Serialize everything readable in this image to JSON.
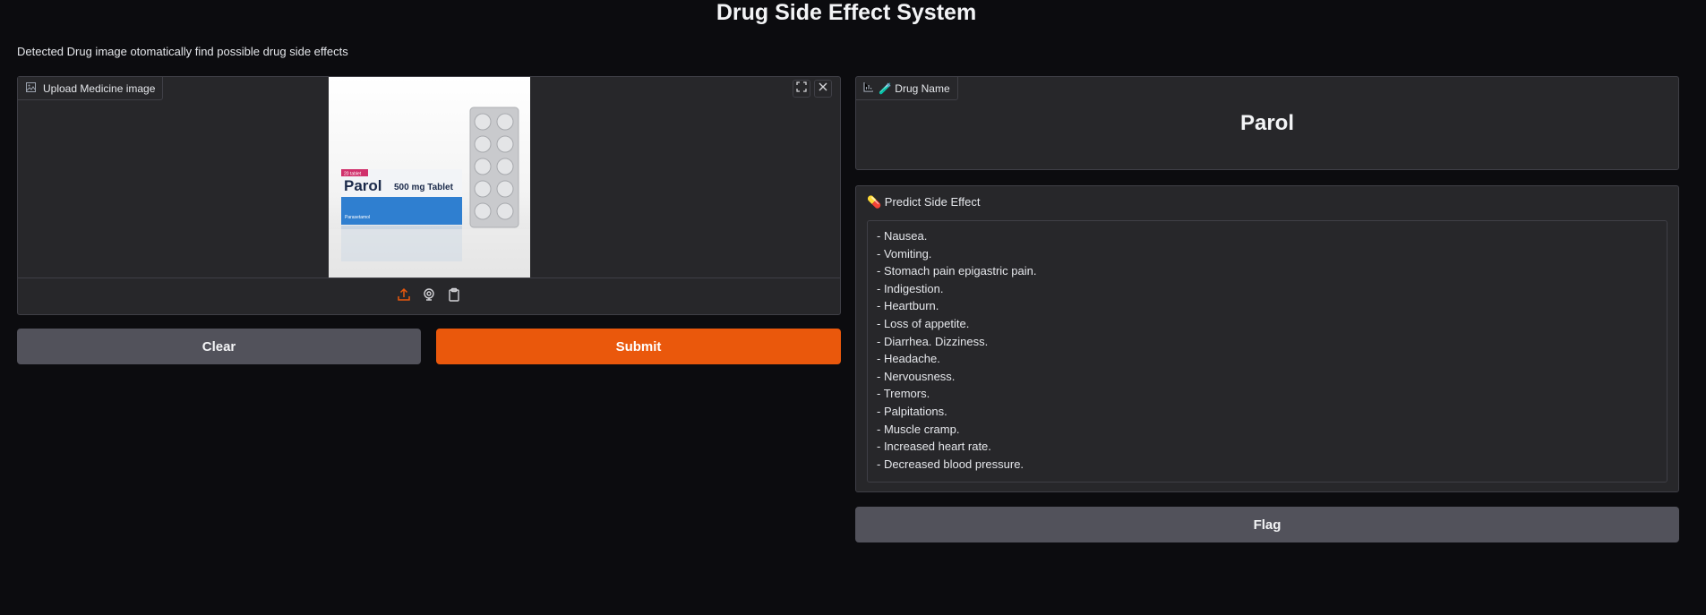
{
  "header": {
    "title": "Drug Side Effect System",
    "subtitle": "Detected Drug image otomatically find possible drug side effects"
  },
  "upload": {
    "label": "Upload Medicine image",
    "image_alt": "Parol 500 mg Tablet package",
    "package_brand": "Parol",
    "package_strength": "500 mg Tablet",
    "package_badge": "20 tablet",
    "package_generic": "Parasetamol"
  },
  "buttons": {
    "clear": "Clear",
    "submit": "Submit",
    "flag": "Flag"
  },
  "drug": {
    "label": "🧪 Drug Name",
    "name": "Parol"
  },
  "side_effect": {
    "label": "💊 Predict Side Effect",
    "lines": [
      "- Nausea.",
      "- Vomiting.",
      "- Stomach pain epigastric pain.",
      "- Indigestion.",
      "- Heartburn.",
      "- Loss of appetite.",
      "- Diarrhea. Dizziness.",
      "- Headache.",
      "- Nervousness.",
      "- Tremors.",
      "- Palpitations.",
      "- Muscle cramp.",
      "- Increased heart rate.",
      "- Decreased blood pressure."
    ]
  },
  "colors": {
    "accent": "#ea580c",
    "background": "#0c0c0f",
    "panel": "#27272a",
    "secondary_button": "#52525b"
  },
  "icons": {
    "upload_label": "image-icon",
    "fullscreen": "fullscreen-icon",
    "close": "close-icon",
    "upload_source": "upload-icon",
    "webcam_source": "webcam-icon",
    "clipboard_source": "clipboard-icon",
    "drug_label": "chart-icon"
  }
}
